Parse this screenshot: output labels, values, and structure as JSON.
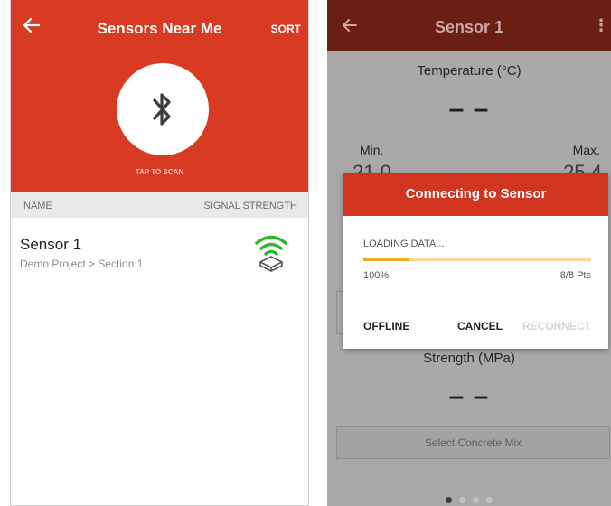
{
  "left_screen": {
    "header": {
      "back_icon": "arrow-left-icon",
      "title": "Sensors Near Me",
      "sort_label": "SORT"
    },
    "scan": {
      "icon": "bluetooth-icon",
      "label": "TAP TO SCAN"
    },
    "columns": {
      "name": "NAME",
      "signal": "SIGNAL STRENGTH"
    },
    "sensors": [
      {
        "name": "Sensor 1",
        "path": "Demo Project > Section 1",
        "signal_icon": "wifi-signal-sensor-icon"
      }
    ]
  },
  "right_screen": {
    "header": {
      "back_icon": "arrow-left-icon",
      "title": "Sensor 1",
      "menu_glyph": "⋮"
    },
    "temperature": {
      "label": "Temperature (°C)",
      "value": "– –",
      "min_label": "Min.",
      "max_label": "Max.",
      "min_value": "21.0",
      "max_value": "25.4"
    },
    "strength": {
      "label": "Strength (MPa)",
      "value": "– –"
    },
    "concrete_mix_label": "Select Concrete Mix",
    "pager": {
      "count": 4,
      "active": 0
    },
    "dialog": {
      "title": "Connecting to Sensor",
      "status": "LOADING DATA...",
      "progress": 0.2,
      "percent_text": "100%",
      "points_text": "8/8 Pts",
      "buttons": {
        "offline": "OFFLINE",
        "cancel": "CANCEL",
        "reconnect": "RECONNECT"
      }
    }
  },
  "colors": {
    "primary_red": "#d83a22",
    "dialog_red": "#d13521",
    "dim_header": "#6b1f12",
    "progress_orange": "#f0a818"
  }
}
